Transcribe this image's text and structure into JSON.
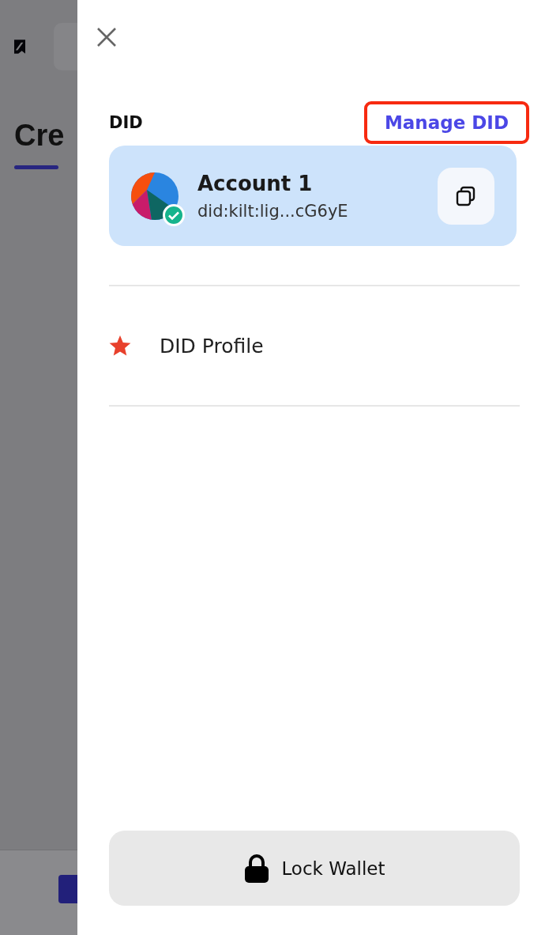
{
  "background": {
    "heading": "Cre"
  },
  "drawer": {
    "section_label": "DID",
    "manage_link": {
      "label": "Manage DID",
      "highlighted": true
    },
    "account": {
      "name": "Account 1",
      "did": "did:kilt:lig...cG6yE",
      "verified": true
    },
    "menu": [
      {
        "label": "DID Profile"
      }
    ],
    "lock_button": {
      "label": "Lock Wallet"
    }
  }
}
